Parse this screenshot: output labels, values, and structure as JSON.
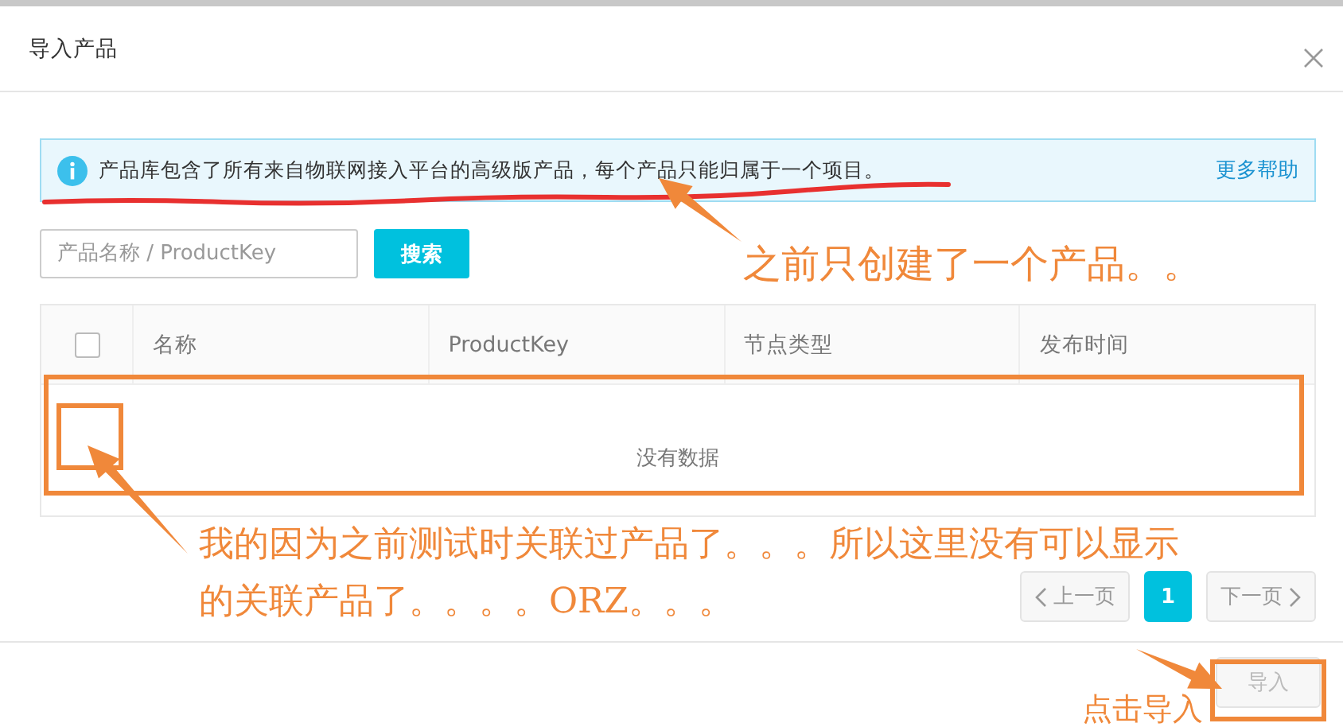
{
  "dialog": {
    "title": "导入产品"
  },
  "alert": {
    "text": "产品库包含了所有来自物联网接入平台的高级版产品，每个产品只能归属于一个项目。",
    "link": "更多帮助"
  },
  "search": {
    "placeholder": "产品名称 / ProductKey",
    "button": "搜索"
  },
  "table": {
    "select_all_checked": false,
    "columns": [
      {
        "label": "名称"
      },
      {
        "label": "ProductKey"
      },
      {
        "label": "节点类型"
      },
      {
        "label": "发布时间"
      }
    ],
    "empty_text": "没有数据"
  },
  "pagination": {
    "prev": {
      "label": "上一页",
      "disabled": true
    },
    "pages": [
      {
        "label": "1",
        "selected": true
      }
    ],
    "next": {
      "label": "下一页",
      "disabled": true
    }
  },
  "footer": {
    "button": {
      "label": "导入",
      "disabled": true
    }
  },
  "annotations": [
    {
      "text": "之前只创建了一个产品。。"
    },
    {
      "text": "我的因为之前测试时关联过产品了。。。所以这里没有可以显示"
    },
    {
      "text": "的关联产品了。。。。ORZ。。。"
    },
    {
      "text": "点击导入"
    }
  ]
}
